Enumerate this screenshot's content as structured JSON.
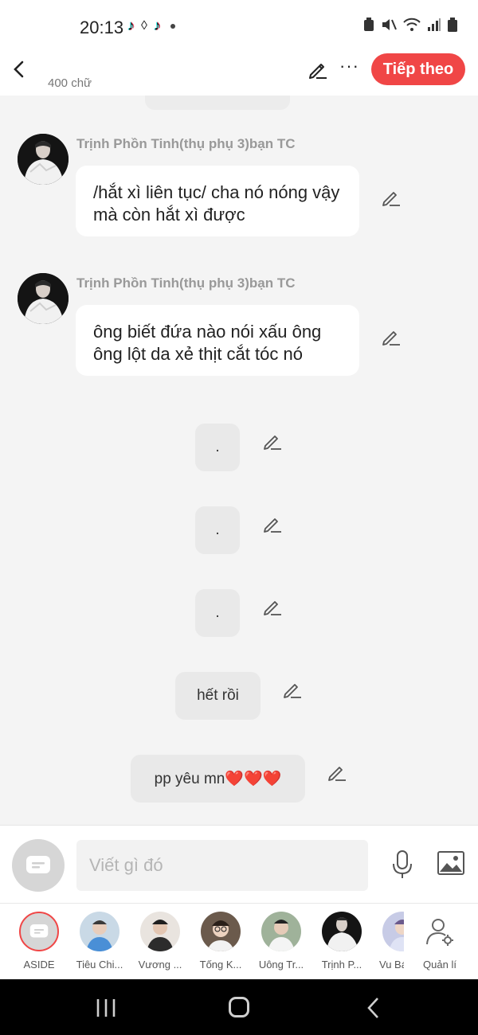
{
  "status_bar": {
    "time": "20:13"
  },
  "header": {
    "word_count": "400 chữ",
    "next_label": "Tiếp theo"
  },
  "messages": [
    {
      "sender": "Trịnh Phồn Tinh(thụ phụ 3)bạn TC",
      "text": "/hắt xì liên tục/ cha nó nóng vậy mà còn hắt xì được"
    },
    {
      "sender": "Trịnh Phồn Tinh(thụ phụ 3)bạn TC",
      "text": "ông biết đứa nào nói xấu ông ông lột da xẻ thịt cắt tóc nó"
    }
  ],
  "narration": [
    {
      "text": "."
    },
    {
      "text": "."
    },
    {
      "text": "."
    },
    {
      "text": "hết rồi"
    },
    {
      "text": "pp yêu mn❤️❤️❤️"
    }
  ],
  "composer": {
    "placeholder": "Viết gì đó"
  },
  "characters": [
    {
      "name": "ASIDE"
    },
    {
      "name": "Tiêu Chi..."
    },
    {
      "name": "Vương ..."
    },
    {
      "name": "Tống K..."
    },
    {
      "name": "Uông Tr..."
    },
    {
      "name": "Trịnh P..."
    },
    {
      "name": "Vu Bá"
    },
    {
      "name": "Quản lí"
    }
  ],
  "colors": {
    "accent": "#f04646",
    "background": "#f4f4f4"
  }
}
